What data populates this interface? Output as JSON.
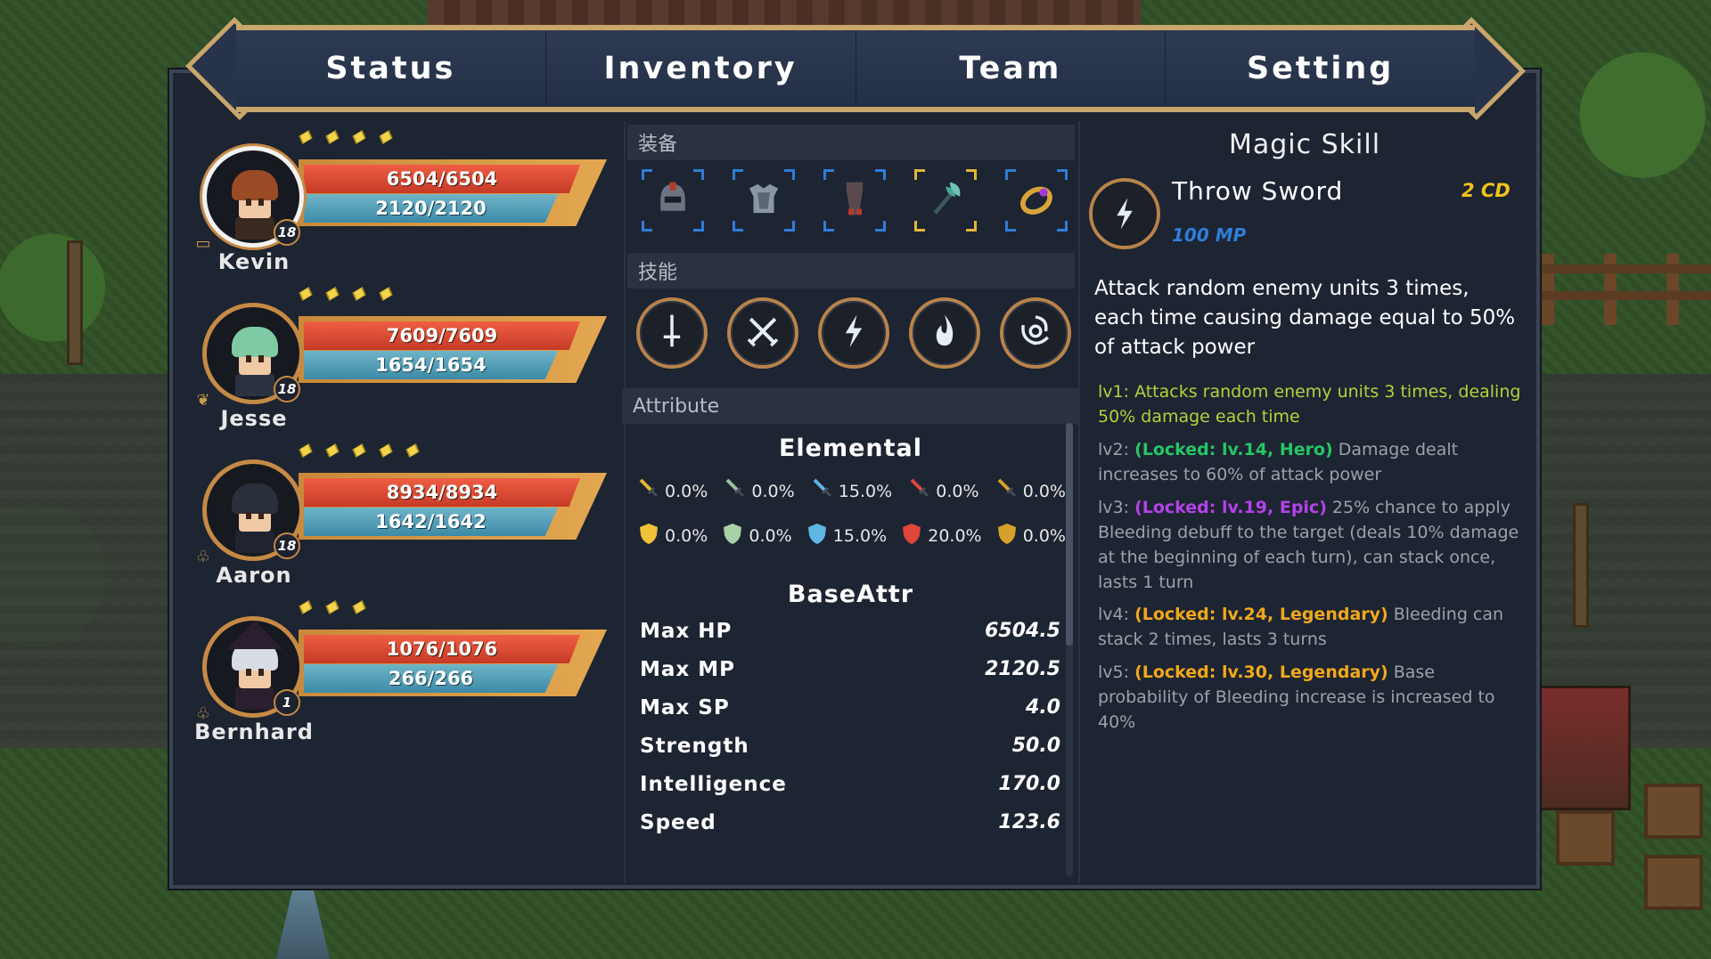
{
  "tabs": [
    "Status",
    "Inventory",
    "Team",
    "Setting"
  ],
  "characters": [
    {
      "name": "Kevin",
      "hp": "6504/6504",
      "mp": "2120/2120",
      "level": "18",
      "stars": 4,
      "selected": true,
      "hair": "#9b4a26",
      "outfit": "#3a2a22",
      "class_icon": "card-icon"
    },
    {
      "name": "Jesse",
      "hp": "7609/7609",
      "mp": "1654/1654",
      "level": "18",
      "stars": 4,
      "selected": false,
      "hair": "#7fc9a4",
      "outfit": "#2b3340",
      "class_icon": "leaf-icon"
    },
    {
      "name": "Aaron",
      "hp": "8934/8934",
      "mp": "1642/1642",
      "level": "18",
      "stars": 5,
      "selected": false,
      "hair": "#2a2f3c",
      "outfit": "#1f2430",
      "class_icon": "knot-icon"
    },
    {
      "name": "Bernhard",
      "hp": "1076/1076",
      "mp": "266/266",
      "level": "1",
      "stars": 3,
      "selected": false,
      "hair": "#d8dde3",
      "outfit": "#2b1f2f",
      "class_icon": "knot-icon"
    }
  ],
  "equipment_label": "装备",
  "equipment": [
    {
      "name": "helmet",
      "frame": "blue"
    },
    {
      "name": "armor",
      "frame": "blue"
    },
    {
      "name": "leggings",
      "frame": "blue"
    },
    {
      "name": "axe",
      "frame": "gold"
    },
    {
      "name": "ring",
      "frame": "blue"
    }
  ],
  "skills_label": "技能",
  "skills": [
    "sword-skill",
    "crossed-swords-skill",
    "lightning-skill",
    "fire-skill",
    "vortex-skill"
  ],
  "attribute_label": "Attribute",
  "elemental_title": "Elemental",
  "elemental_attack": [
    {
      "value": "0.0%",
      "color": "#e3b53a"
    },
    {
      "value": "0.0%",
      "color": "#9bc09a"
    },
    {
      "value": "15.0%",
      "color": "#5fb6e3"
    },
    {
      "value": "0.0%",
      "color": "#e0463a"
    },
    {
      "value": "0.0%",
      "color": "#d6a12b"
    }
  ],
  "elemental_defense": [
    {
      "value": "0.0%",
      "color": "#f0c23a"
    },
    {
      "value": "0.0%",
      "color": "#a9d0a6"
    },
    {
      "value": "15.0%",
      "color": "#5fb6e3"
    },
    {
      "value": "20.0%",
      "color": "#e0463a"
    },
    {
      "value": "0.0%",
      "color": "#d6a12b"
    }
  ],
  "base_title": "BaseAttr",
  "base_attrs": [
    {
      "name": "Max HP",
      "value": "6504.5"
    },
    {
      "name": "Max MP",
      "value": "2120.5"
    },
    {
      "name": "Max SP",
      "value": "4.0"
    },
    {
      "name": "Strength",
      "value": "50.0"
    },
    {
      "name": "Intelligence",
      "value": "170.0"
    },
    {
      "name": "Speed",
      "value": "123.6"
    }
  ],
  "skill_detail": {
    "header": "Magic Skill",
    "name": "Throw Sword",
    "cd": "2 CD",
    "mp": "100 MP",
    "description": "Attack random enemy units 3 times, each time causing damage equal to 50% of attack power",
    "levels": [
      {
        "prefix": "lv1: ",
        "lock": "",
        "lock_class": "",
        "text": "Attacks random enemy units 3 times, dealing 50% damage each time",
        "active": true
      },
      {
        "prefix": "lv2: ",
        "lock": "(Locked: lv.14, Hero)",
        "lock_class": "k-hero",
        "text": " Damage dealt increases to 60% of attack power",
        "active": false
      },
      {
        "prefix": "lv3: ",
        "lock": "(Locked: lv.19, Epic)",
        "lock_class": "k-epic",
        "text": " 25% chance to apply Bleeding debuff to the target (deals 10% damage at the beginning of each turn), can stack once, lasts 1 turn",
        "active": false
      },
      {
        "prefix": "lv4: ",
        "lock": "(Locked: lv.24, Legendary)",
        "lock_class": "k-leg",
        "text": " Bleeding can stack 2 times, lasts 3 turns",
        "active": false
      },
      {
        "prefix": "lv5: ",
        "lock": "(Locked: lv.30, Legendary)",
        "lock_class": "k-leg",
        "text": " Base probability of Bleeding increase is increased to 40%",
        "active": false
      }
    ]
  }
}
